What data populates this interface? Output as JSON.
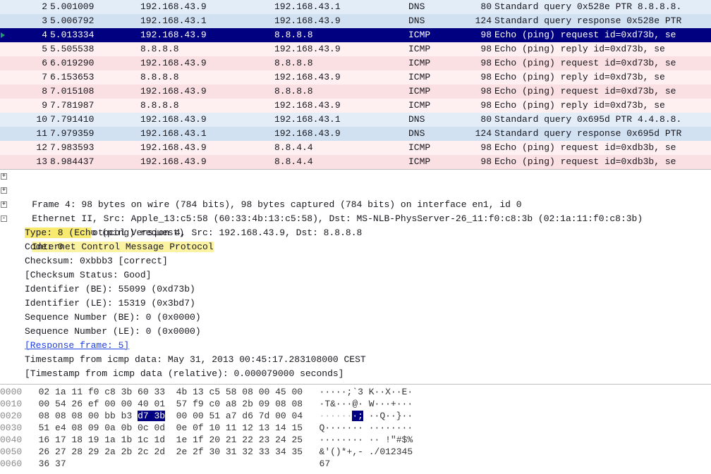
{
  "packets": [
    {
      "no": "2",
      "time": "5.001009",
      "src": "192.168.43.9",
      "dst": "192.168.43.1",
      "proto": "DNS",
      "len": "80",
      "info": "Standard query 0x528e PTR 8.8.8.8.",
      "cls": "c-light"
    },
    {
      "no": "3",
      "time": "5.006792",
      "src": "192.168.43.1",
      "dst": "192.168.43.9",
      "proto": "DNS",
      "len": "124",
      "info": "Standard query response 0x528e PTR",
      "cls": "c-dark"
    },
    {
      "no": "4",
      "time": "5.013334",
      "src": "192.168.43.9",
      "dst": "8.8.8.8",
      "proto": "ICMP",
      "len": "98",
      "info": "Echo (ping) request  id=0xd73b, se",
      "cls": "c-sel",
      "arrow": true
    },
    {
      "no": "5",
      "time": "5.505538",
      "src": "8.8.8.8",
      "dst": "192.168.43.9",
      "proto": "ICMP",
      "len": "98",
      "info": "Echo (ping) reply    id=0xd73b, se",
      "cls": "c-pink"
    },
    {
      "no": "6",
      "time": "6.019290",
      "src": "192.168.43.9",
      "dst": "8.8.8.8",
      "proto": "ICMP",
      "len": "98",
      "info": "Echo (ping) request  id=0xd73b, se",
      "cls": "c-pinkd"
    },
    {
      "no": "7",
      "time": "6.153653",
      "src": "8.8.8.8",
      "dst": "192.168.43.9",
      "proto": "ICMP",
      "len": "98",
      "info": "Echo (ping) reply    id=0xd73b, se",
      "cls": "c-pink"
    },
    {
      "no": "8",
      "time": "7.015108",
      "src": "192.168.43.9",
      "dst": "8.8.8.8",
      "proto": "ICMP",
      "len": "98",
      "info": "Echo (ping) request  id=0xd73b, se",
      "cls": "c-pinkd"
    },
    {
      "no": "9",
      "time": "7.781987",
      "src": "8.8.8.8",
      "dst": "192.168.43.9",
      "proto": "ICMP",
      "len": "98",
      "info": "Echo (ping) reply    id=0xd73b, se",
      "cls": "c-pink"
    },
    {
      "no": "10",
      "time": "7.791410",
      "src": "192.168.43.9",
      "dst": "192.168.43.1",
      "proto": "DNS",
      "len": "80",
      "info": "Standard query 0x695d PTR 4.4.8.8.",
      "cls": "c-light"
    },
    {
      "no": "11",
      "time": "7.979359",
      "src": "192.168.43.1",
      "dst": "192.168.43.9",
      "proto": "DNS",
      "len": "124",
      "info": "Standard query response 0x695d PTR",
      "cls": "c-dark"
    },
    {
      "no": "12",
      "time": "7.983593",
      "src": "192.168.43.9",
      "dst": "8.8.4.4",
      "proto": "ICMP",
      "len": "98",
      "info": "Echo (ping) request  id=0xdb3b, se",
      "cls": "c-pink"
    },
    {
      "no": "13",
      "time": "8.984437",
      "src": "192.168.43.9",
      "dst": "8.8.4.4",
      "proto": "ICMP",
      "len": "98",
      "info": "Echo (ping) request  id=0xdb3b, se",
      "cls": "c-pinkd"
    }
  ],
  "details": {
    "frame": "Frame 4: 98 bytes on wire (784 bits), 98 bytes captured (784 bits) on interface en1, id 0",
    "eth": "Ethernet II, Src: Apple_13:c5:58 (60:33:4b:13:c5:58), Dst: MS-NLB-PhysServer-26_11:f0:c8:3b (02:1a:11:f0:c8:3b)",
    "ip": "Internet Protocol Version 4, Src: 192.168.43.9, Dst: 8.8.8.8",
    "icmp_hdr": "Internet Control Message Protocol",
    "type_hl": "Type: 8 (Ech",
    "type_rest": "o (ping) request)",
    "code": "Code: 0",
    "cksum": "Checksum: 0xbbb3 [correct]",
    "ckstat": "[Checksum Status: Good]",
    "id_be": "Identifier (BE): 55099 (0xd73b)",
    "id_le": "Identifier (LE): 15319 (0x3bd7)",
    "seq_be": "Sequence Number (BE): 0 (0x0000)",
    "seq_le": "Sequence Number (LE): 0 (0x0000)",
    "resp": "[Response frame: 5]",
    "ts": "Timestamp from icmp data: May 31, 2013 00:45:17.283108000 CEST",
    "tsr": "[Timestamp from icmp data (relative): 0.000079000 seconds]"
  },
  "hex": {
    "lines": [
      {
        "off": "0000",
        "a": "02 1a 11 f0 c8 3b 60 33",
        "b": "4b 13 c5 58 08 00 45 00",
        "asc": "·····;`3 K··X··E·"
      },
      {
        "off": "0010",
        "a": "00 54 26 ef 00 00 40 01",
        "b": "57 f9 c0 a8 2b 09 08 08",
        "asc": "·T&···@· W···+···"
      },
      {
        "off": "0020",
        "a": "08 08 08 00 bb b3 ",
        "hl": "d7 3b",
        "b": "00 00 51 a7 d6 7d 00 04",
        "asc1": "······",
        "asc_hl": "·;",
        "asc2": " ··Q··}··"
      },
      {
        "off": "0030",
        "a": "51 e4 08 09 0a 0b 0c 0d",
        "b": "0e 0f 10 11 12 13 14 15",
        "asc": "Q······· ········"
      },
      {
        "off": "0040",
        "a": "16 17 18 19 1a 1b 1c 1d",
        "b": "1e 1f 20 21 22 23 24 25",
        "asc": "········ ·· !\"#$%"
      },
      {
        "off": "0050",
        "a": "26 27 28 29 2a 2b 2c 2d",
        "b": "2e 2f 30 31 32 33 34 35",
        "asc": "&'()*+,- ./012345"
      },
      {
        "off": "0060",
        "a": "36 37                  ",
        "b": "                       ",
        "asc": "67"
      }
    ]
  }
}
